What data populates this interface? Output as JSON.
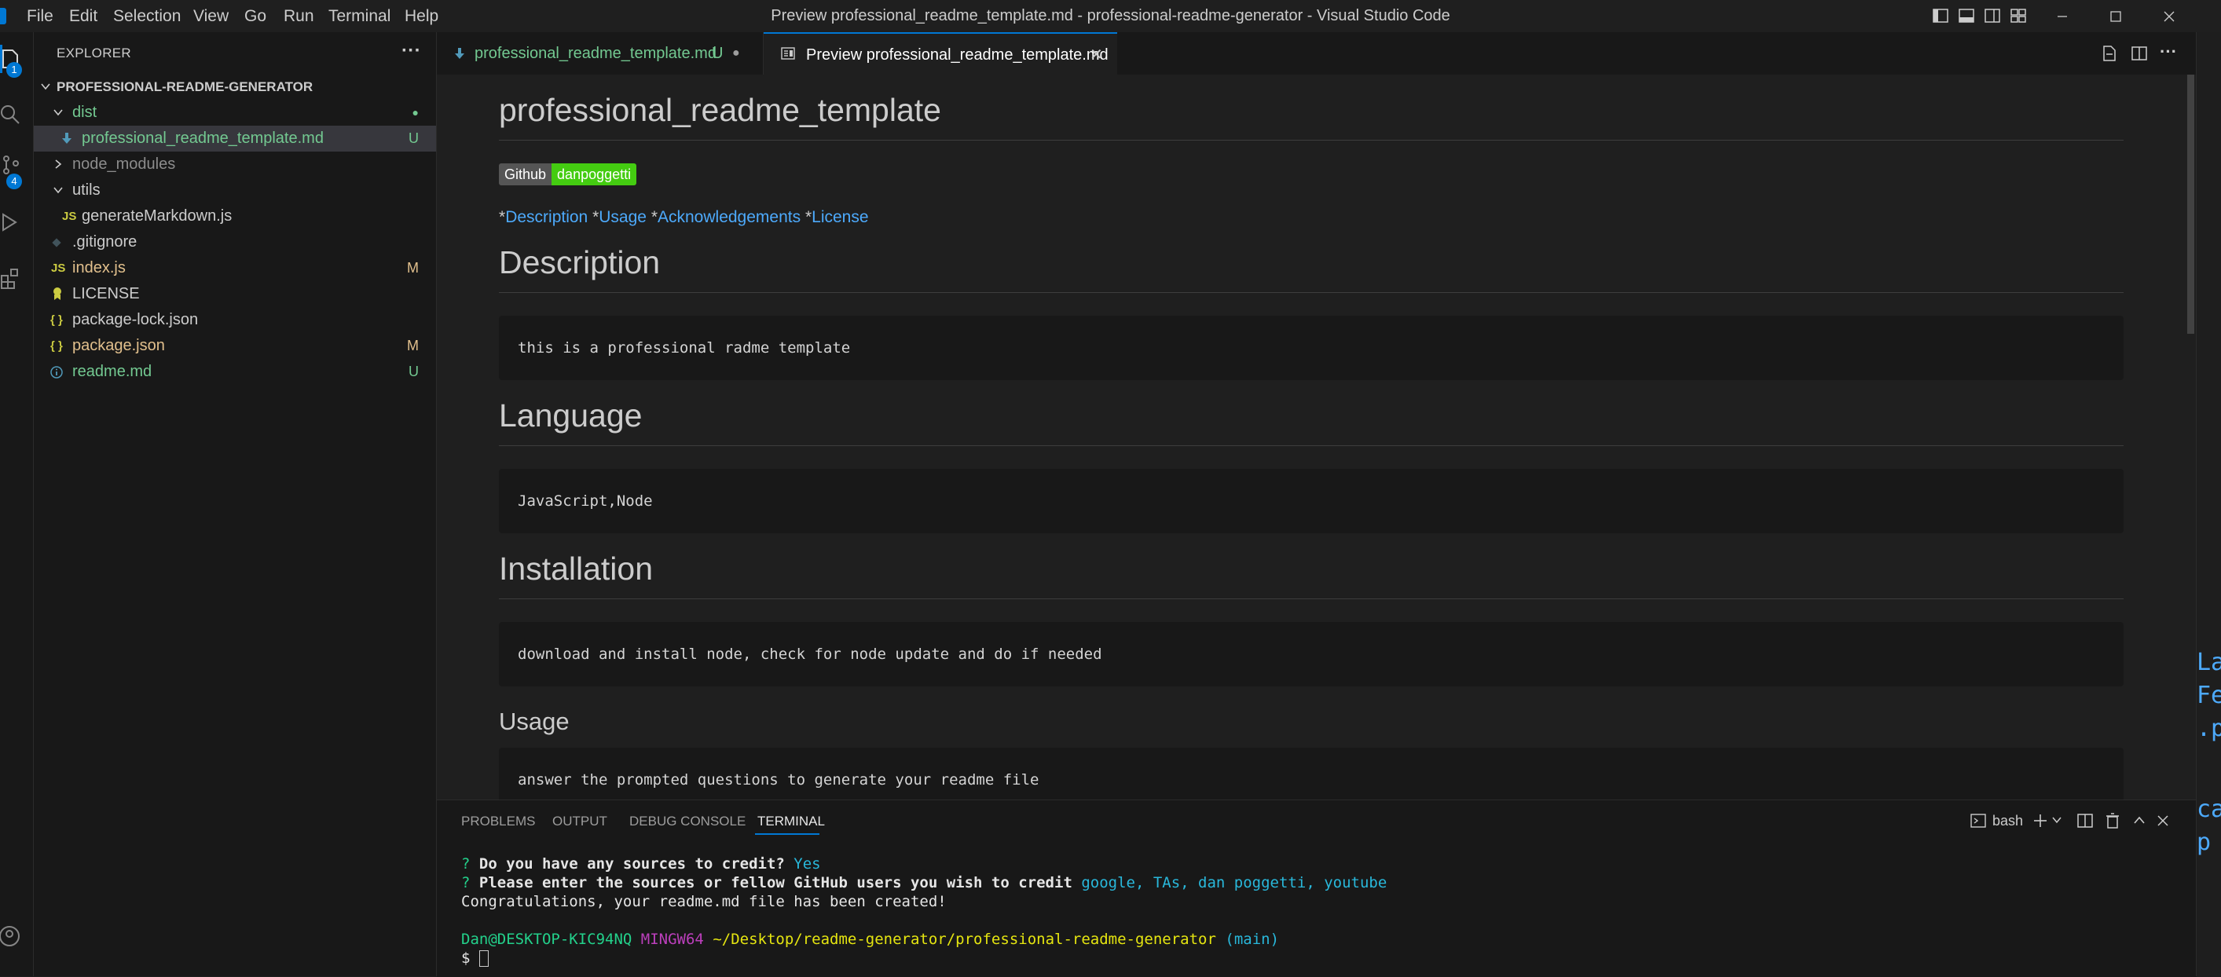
{
  "menu": [
    "File",
    "Edit",
    "Selection",
    "View",
    "Go",
    "Run",
    "Terminal",
    "Help"
  ],
  "window_title": "Preview professional_readme_template.md - professional-readme-generator - Visual Studio Code",
  "activity": {
    "explorer_badge": "1",
    "scm_badge": "4"
  },
  "sidebar": {
    "title": "EXPLORER",
    "more": "···",
    "root": "PROFESSIONAL-README-GENERATOR",
    "items": [
      {
        "name": "dist",
        "status": "●",
        "kind": "folder-open"
      },
      {
        "name": "professional_readme_template.md",
        "status": "U",
        "kind": "md"
      },
      {
        "name": "node_modules",
        "status": "",
        "kind": "folder-closed"
      },
      {
        "name": "utils",
        "status": "",
        "kind": "folder-open"
      },
      {
        "name": "generateMarkdown.js",
        "status": "",
        "kind": "js"
      },
      {
        "name": ".gitignore",
        "status": "",
        "kind": "git"
      },
      {
        "name": "index.js",
        "status": "M",
        "kind": "js"
      },
      {
        "name": "LICENSE",
        "status": "",
        "kind": "license"
      },
      {
        "name": "package-lock.json",
        "status": "",
        "kind": "json"
      },
      {
        "name": "package.json",
        "status": "M",
        "kind": "json"
      },
      {
        "name": "readme.md",
        "status": "U",
        "kind": "info"
      }
    ]
  },
  "tabs": [
    {
      "label": "professional_readme_template.md",
      "status": "U",
      "dirty": "●"
    },
    {
      "label": "Preview professional_readme_template.md",
      "close": "✕"
    }
  ],
  "preview": {
    "title": "professional_readme_template",
    "badge_left": "Github",
    "badge_right": "danpoggetti",
    "toc": {
      "star": "*",
      "links": [
        "Description",
        "Usage",
        "Acknowledgements",
        "License"
      ]
    },
    "sections": [
      {
        "heading": "Description",
        "code": "this is a professional radme template"
      },
      {
        "heading": "Language",
        "code": "JavaScript,Node"
      },
      {
        "heading": "Installation",
        "code": "download and install node, check for node update and do if needed"
      },
      {
        "heading": "Usage",
        "code": "answer the prompted questions to generate your readme file"
      }
    ]
  },
  "panel": {
    "tabs": [
      "PROBLEMS",
      "OUTPUT",
      "DEBUG CONSOLE",
      "TERMINAL"
    ],
    "active_tab": "TERMINAL",
    "shell": "bash",
    "terminal": {
      "q_mark": "?",
      "q1": "Do you have any sources to credit?",
      "a1": "Yes",
      "q2": "Please enter the sources or fellow GitHub users you wish to credit",
      "a2": "google, TAs, dan poggetti, youtube",
      "done": "Congratulations, your readme.md file has been created!",
      "user": "Dan@DESKTOP-KIC94NQ",
      "env": "MINGW64",
      "path": "~/Desktop/readme-generator/professional-readme-generator",
      "branch": "(main)",
      "prompt": "$"
    }
  },
  "right_strip_text": [
    "La",
    "Fe",
    ".p",
    "ca",
    "p"
  ],
  "colors": {
    "accent": "#0078d4",
    "untracked": "#73c991",
    "modified": "#e2c08d",
    "link": "#4daafc",
    "badge_green": "#4c1",
    "badge_gray": "#555555"
  }
}
